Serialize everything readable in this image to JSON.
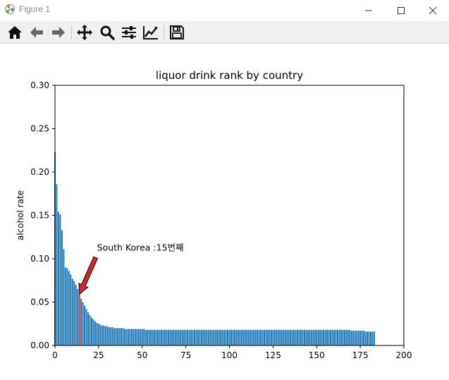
{
  "window": {
    "title": "Figure 1"
  },
  "toolbar": {
    "tools": [
      {
        "name": "home-icon"
      },
      {
        "name": "back-arrow-icon"
      },
      {
        "name": "forward-arrow-icon"
      },
      {
        "name": "pan-icon"
      },
      {
        "name": "zoom-icon"
      },
      {
        "name": "subplots-config-icon"
      },
      {
        "name": "edit-axes-icon"
      },
      {
        "name": "save-icon"
      }
    ]
  },
  "colors": {
    "bar": "#1f77b4",
    "highlight": "#d62728"
  },
  "chart_data": {
    "type": "bar",
    "title": "liquor drink rank by country",
    "xlabel": "",
    "ylabel": "alcohol rate",
    "xlim": [
      0,
      200
    ],
    "ylim": [
      0,
      0.3
    ],
    "xticks": [
      "0",
      "25",
      "50",
      "75",
      "100",
      "125",
      "150",
      "175",
      "200"
    ],
    "yticks": [
      "0.00",
      "0.05",
      "0.10",
      "0.15",
      "0.20",
      "0.25",
      "0.30"
    ],
    "grid": false,
    "highlight_index": 14,
    "annotation": "South Korea :15번째",
    "values": [
      0.223,
      0.186,
      0.154,
      0.151,
      0.133,
      0.111,
      0.09,
      0.089,
      0.086,
      0.082,
      0.077,
      0.074,
      0.07,
      0.065,
      0.059,
      0.054,
      0.05,
      0.046,
      0.042,
      0.038,
      0.035,
      0.032,
      0.03,
      0.028,
      0.026,
      0.025,
      0.024,
      0.023,
      0.023,
      0.022,
      0.022,
      0.021,
      0.021,
      0.021,
      0.02,
      0.02,
      0.02,
      0.02,
      0.02,
      0.02,
      0.019,
      0.019,
      0.019,
      0.019,
      0.019,
      0.019,
      0.019,
      0.019,
      0.019,
      0.019,
      0.019,
      0.019,
      0.018,
      0.018,
      0.018,
      0.018,
      0.018,
      0.018,
      0.018,
      0.018,
      0.018,
      0.018,
      0.018,
      0.018,
      0.018,
      0.018,
      0.018,
      0.018,
      0.018,
      0.018,
      0.018,
      0.018,
      0.018,
      0.018,
      0.018,
      0.018,
      0.018,
      0.018,
      0.018,
      0.018,
      0.018,
      0.018,
      0.018,
      0.018,
      0.018,
      0.018,
      0.018,
      0.018,
      0.018,
      0.018,
      0.018,
      0.018,
      0.018,
      0.018,
      0.018,
      0.018,
      0.018,
      0.018,
      0.018,
      0.018,
      0.018,
      0.018,
      0.018,
      0.018,
      0.018,
      0.018,
      0.018,
      0.018,
      0.018,
      0.018,
      0.018,
      0.018,
      0.018,
      0.018,
      0.018,
      0.018,
      0.018,
      0.018,
      0.018,
      0.018,
      0.018,
      0.018,
      0.018,
      0.018,
      0.018,
      0.018,
      0.018,
      0.018,
      0.018,
      0.018,
      0.018,
      0.018,
      0.018,
      0.018,
      0.018,
      0.018,
      0.018,
      0.018,
      0.018,
      0.018,
      0.018,
      0.018,
      0.018,
      0.018,
      0.018,
      0.018,
      0.018,
      0.018,
      0.018,
      0.018,
      0.018,
      0.018,
      0.018,
      0.018,
      0.018,
      0.018,
      0.018,
      0.018,
      0.018,
      0.018,
      0.018,
      0.018,
      0.018,
      0.018,
      0.018,
      0.018,
      0.018,
      0.018,
      0.018,
      0.018,
      0.017,
      0.017,
      0.017,
      0.017,
      0.017,
      0.017,
      0.017,
      0.017,
      0.016,
      0.016,
      0.016,
      0.016,
      0.016,
      0.016
    ]
  }
}
